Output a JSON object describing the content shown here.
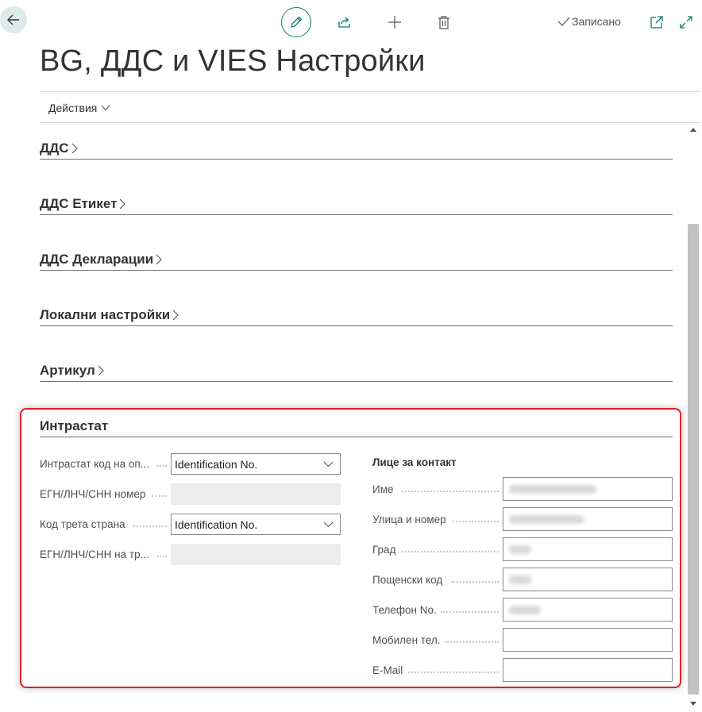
{
  "header": {
    "saved_label": "Записано"
  },
  "page": {
    "title": "BG, ДДС и VIES Настройки",
    "actions_label": "Действия"
  },
  "sections": [
    {
      "title": "ДДС"
    },
    {
      "title": "ДДС Етикет"
    },
    {
      "title": "ДДС Декларации"
    },
    {
      "title": "Локални настройки"
    },
    {
      "title": "Артикул"
    },
    {
      "title": "Интрастат"
    }
  ],
  "intrastat": {
    "left_fields": [
      {
        "label": "Интрастат код на оп...",
        "value": "Identification No."
      },
      {
        "label": "ЕГН/ЛНЧ/СНН номер",
        "value": ""
      },
      {
        "label": "Код трета страна",
        "value": "Identification No."
      },
      {
        "label": "ЕГН/ЛНЧ/СНН на тр...",
        "value": ""
      }
    ],
    "contact_heading": "Лице за контакт",
    "contact_fields": [
      {
        "label": "Име",
        "value": ""
      },
      {
        "label": "Улица и номер",
        "value": ""
      },
      {
        "label": "Град",
        "value": ""
      },
      {
        "label": "Пощенски код",
        "value": ""
      },
      {
        "label": "Телефон No.",
        "value": ""
      },
      {
        "label": "Мобилен тел.",
        "value": ""
      },
      {
        "label": "E-Mail",
        "value": ""
      }
    ]
  },
  "colors": {
    "accent": "#0f7b73",
    "highlight_border": "#e0202a"
  },
  "icons": [
    "back-arrow-icon",
    "pencil-icon",
    "share-icon",
    "plus-icon",
    "trash-icon",
    "checkmark-icon",
    "popout-icon",
    "expand-icon",
    "chevron-down-icon",
    "chevron-right-icon"
  ]
}
